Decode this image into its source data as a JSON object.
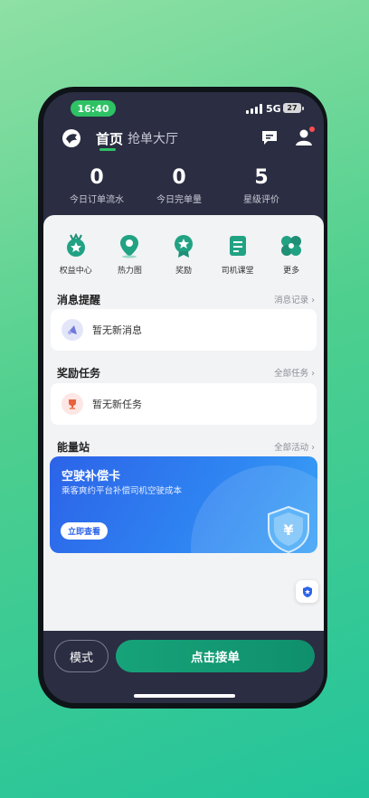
{
  "status_bar": {
    "time": "16:40",
    "network": "5G",
    "battery": "27"
  },
  "nav": {
    "logo": "horse-logo-icon",
    "tabs": [
      {
        "label": "首页",
        "active": true
      },
      {
        "label": "抢单大厅",
        "active": false
      }
    ],
    "message_icon": "message-icon",
    "user_icon": "user-icon"
  },
  "stats": [
    {
      "value": "0",
      "label": "今日订单流水"
    },
    {
      "value": "0",
      "label": "今日完单量"
    },
    {
      "value": "5",
      "label": "星级评价"
    }
  ],
  "quick_actions": [
    {
      "label": "权益中心",
      "icon": "badge-icon"
    },
    {
      "label": "热力图",
      "icon": "location-pin-icon"
    },
    {
      "label": "奖励",
      "icon": "medal-icon"
    },
    {
      "label": "司机课堂",
      "icon": "book-icon"
    },
    {
      "label": "更多",
      "icon": "grid-more-icon"
    }
  ],
  "messages": {
    "title": "消息提醒",
    "link": "消息记录",
    "empty_text": "暂无新消息"
  },
  "rewards": {
    "title": "奖励任务",
    "link": "全部任务",
    "empty_text": "暂无新任务"
  },
  "energy": {
    "title": "能量站",
    "link": "全部活动",
    "card_title": "空驶补偿卡",
    "card_subtitle": "乘客爽约平台补偿司机空驶成本",
    "card_button": "立即查看"
  },
  "bottom": {
    "mode_label": "模式",
    "accept_label": "点击接单"
  },
  "colors": {
    "accent": "#2ec265",
    "primary_button": "#17a37a",
    "card_blue": "#2c63e8"
  }
}
